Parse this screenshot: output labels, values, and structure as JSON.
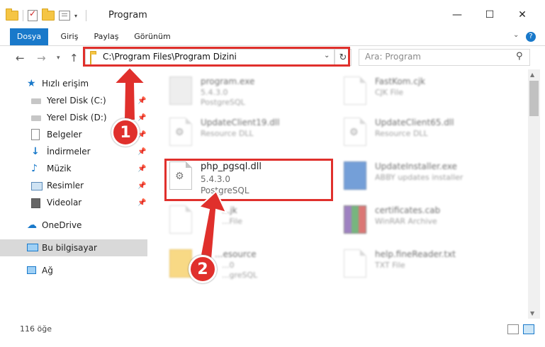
{
  "window": {
    "title": "Program",
    "minimize": "—",
    "maximize": "☐",
    "close": "✕"
  },
  "ribbon": {
    "tabs": [
      "Dosya",
      "Giriş",
      "Paylaş",
      "Görünüm"
    ],
    "help": "?"
  },
  "address": {
    "path": "C:\\Program Files\\Program Dizini"
  },
  "search": {
    "placeholder": "Ara: Program"
  },
  "sidebar": {
    "items": [
      {
        "label": "Hızlı erişim",
        "icon": "star-icon"
      },
      {
        "label": "Yerel Disk (C:)",
        "icon": "drive-icon"
      },
      {
        "label": "Yerel Disk (D:)",
        "icon": "drive-icon"
      },
      {
        "label": "Belgeler",
        "icon": "documents-icon"
      },
      {
        "label": "İndirmeler",
        "icon": "download-icon"
      },
      {
        "label": "Müzik",
        "icon": "music-icon"
      },
      {
        "label": "Resimler",
        "icon": "pictures-icon"
      },
      {
        "label": "Videolar",
        "icon": "videos-icon"
      },
      {
        "label": "OneDrive",
        "icon": "cloud-icon"
      },
      {
        "label": "Bu bilgisayar",
        "icon": "computer-icon"
      },
      {
        "label": "Ağ",
        "icon": "network-icon"
      }
    ]
  },
  "files": [
    {
      "name": "program.exe",
      "line1": "5.4.3.0",
      "line2": "PostgreSQL"
    },
    {
      "name": "FastKom.cjk",
      "line1": "CJK File",
      "line2": ""
    },
    {
      "name": "UpdateClient19.dll",
      "line1": "Resource DLL",
      "line2": ""
    },
    {
      "name": "UpdateClient65.dll",
      "line1": "Resource DLL",
      "line2": ""
    },
    {
      "name": "php_pgsql.dll",
      "line1": "5.4.3.0",
      "line2": "PostgreSQL"
    },
    {
      "name": "UpdateInstaller.exe",
      "line1": "ABBY updates installer",
      "line2": ""
    },
    {
      "name": "...jk",
      "line1": "...File",
      "line2": ""
    },
    {
      "name": "certificates.cab",
      "line1": "WinRAR Archive",
      "line2": ""
    },
    {
      "name": "...esource",
      "line1": "...0",
      "line2": "...greSQL"
    },
    {
      "name": "help.fineReader.txt",
      "line1": "TXT File",
      "line2": ""
    }
  ],
  "markers": [
    "1",
    "2"
  ],
  "status": {
    "count": "116 öğe"
  },
  "colors": {
    "accent": "#1979ca",
    "highlight": "#e0302c",
    "selected_row": "#d9d9d9"
  }
}
